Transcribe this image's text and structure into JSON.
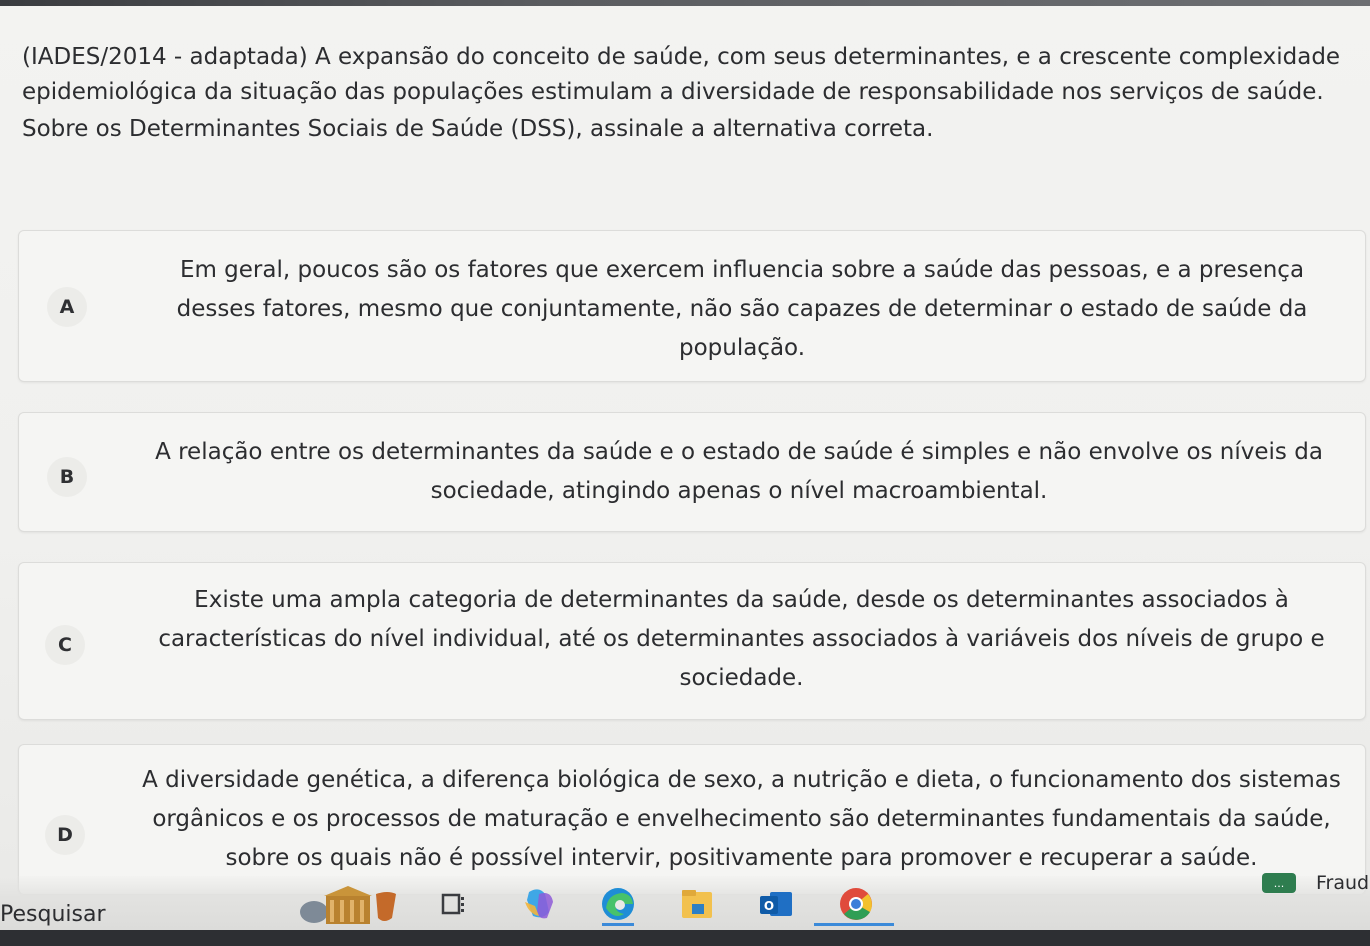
{
  "question": {
    "statement": "(IADES/2014 - adaptada) A expansão do conceito de saúde, com seus determinantes, e a crescente complexidade epidemiológica da situação das populações estimulam a diversidade de responsabilidade nos serviços de saúde.",
    "instruction": "Sobre os Determinantes Sociais de Saúde (DSS), assinale a alternativa correta."
  },
  "options": [
    {
      "letter": "A",
      "text": "Em geral, poucos são os fatores que exercem influencia sobre a saúde das pessoas, e a presença desses fatores, mesmo que conjuntamente, não são capazes de determinar o estado de saúde da população."
    },
    {
      "letter": "B",
      "text": "A relação entre os determinantes da saúde e o estado de saúde é simples e não envolve os níveis da sociedade, atingindo apenas o nível macroambiental."
    },
    {
      "letter": "C",
      "text": "Existe uma ampla categoria de determinantes da saúde, desde os determinantes associados à características do nível individual, até os determinantes associados à variáveis dos níveis de grupo e sociedade."
    },
    {
      "letter": "D",
      "text": "A diversidade genética, a diferença biológica de sexo, a nutrição e dieta, o funcionamento dos sistemas orgânicos e os processos de maturação e envelhecimento são determinantes fundamentais da saúde, sobre os quais não é possível intervir, positivamente para promover e recuperar a saúde."
    }
  ],
  "taskbar": {
    "search_label": "Pesquisar",
    "icons": [
      "museum-widget-icon",
      "task-view-icon",
      "copilot-icon",
      "edge-icon",
      "file-explorer-icon",
      "outlook-icon",
      "chrome-icon"
    ],
    "widget_badge": "...",
    "widget_text": "Fraud"
  },
  "colors": {
    "accent": "#3b8ad9",
    "page_background": "#f1f1ef",
    "text": "#2c2d30"
  }
}
